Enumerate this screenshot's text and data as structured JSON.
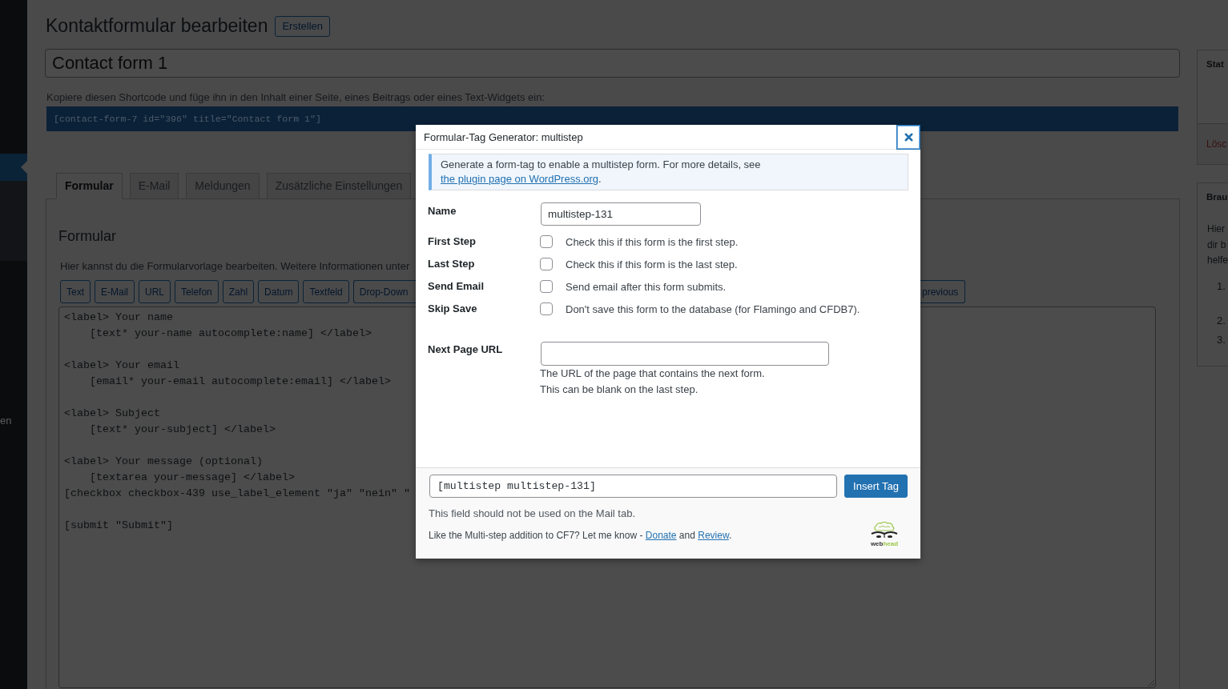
{
  "admin_menu": {
    "items": [
      {
        "selected": true
      },
      {
        "label": "en",
        "selected": false
      }
    ]
  },
  "page": {
    "title": "Kontaktformular bearbeiten",
    "add_button": "Erstellen"
  },
  "form_title": {
    "value": "Contact form 1"
  },
  "shortcode": {
    "hint": "Kopiere diesen Shortcode und füge ihn in den Inhalt einer Seite, eines Beitrags oder eines Text-Widgets ein:",
    "code": "[contact-form-7 id=\"396\" title=\"Contact form 1\"]"
  },
  "tabs": [
    {
      "label": "Formular",
      "selected": true
    },
    {
      "label": "E-Mail",
      "selected": false
    },
    {
      "label": "Meldungen",
      "selected": false
    },
    {
      "label": "Zusätzliche Einstellungen",
      "selected": false
    }
  ],
  "form_panel": {
    "heading": "Formular",
    "description": "Hier kannst du die Formularvorlage bearbeiten. Weitere Informationen unter",
    "tag_buttons": [
      "Text",
      "E-Mail",
      "URL",
      "Telefon",
      "Zahl",
      "Datum",
      "Textfeld",
      "Drop-Down"
    ],
    "tag_buttons_right": [
      "previous"
    ],
    "template_blocks": [
      [
        "<label> Your name",
        "    [text* your-name autocomplete:name] </label>"
      ],
      [
        "<label> Your email",
        "    [email* your-email autocomplete:email] </label>"
      ],
      [
        "<label> Subject",
        "    [text* your-subject] </label>"
      ],
      [
        "<label> Your message (optional)",
        "    [textarea your-message] </label>",
        "[checkbox checkbox-439 use_label_element \"ja\" \"nein\" \""
      ],
      [
        "[submit \"Submit\"]"
      ]
    ]
  },
  "status_box": {
    "heading": "Stat",
    "delete_link": "Lösc"
  },
  "help_box": {
    "heading": "Brau",
    "text_lines": [
      "Hier",
      "dir b",
      "helfe"
    ],
    "list_markers": [
      "1.",
      "2.",
      "3."
    ]
  },
  "dialog": {
    "title": "Formular-Tag Generator: multistep",
    "notice": {
      "text": "Generate a form-tag to enable a multistep form. For more details, see",
      "link": "the plugin page on WordPress.org",
      "after": "."
    },
    "name_field": {
      "label": "Name",
      "value": "multistep-131"
    },
    "options": [
      {
        "label": "First Step",
        "checked": false,
        "description": "Check this if this form is the first step."
      },
      {
        "label": "Last Step",
        "checked": false,
        "description": "Check this if this form is the last step."
      },
      {
        "label": "Send Email",
        "checked": false,
        "description": "Send email after this form submits."
      },
      {
        "label": "Skip Save",
        "checked": false,
        "description": "Don't save this form to the database (for Flamingo and CFDB7)."
      }
    ],
    "next_url_field": {
      "label": "Next Page URL",
      "help_lines": [
        "The URL of the page that contains the next form.",
        "This can be blank on the last step."
      ]
    },
    "tag_field": {
      "value": "[multistep multistep-131]"
    },
    "insert_button": "Insert Tag",
    "mail_note": "This field should not be used on the Mail tab.",
    "credit": {
      "before": "Like the Multi-step addition to CF7? Let me know -",
      "donate": "Donate",
      "between": "and",
      "review": "Review",
      "after": "."
    },
    "logo": {
      "words": [
        "web",
        "head"
      ]
    }
  }
}
